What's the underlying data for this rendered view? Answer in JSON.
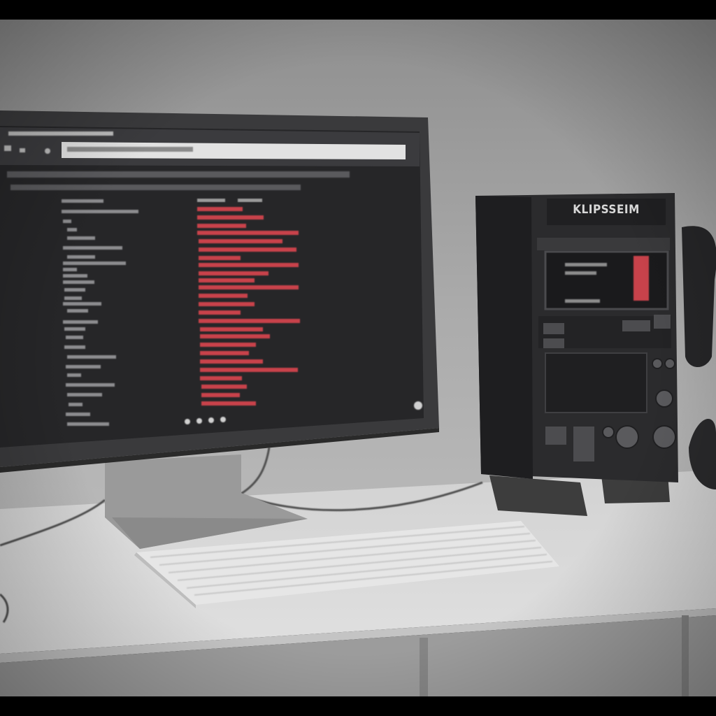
{
  "photo": {
    "device": {
      "brand_label": "KLIPSSEIM"
    },
    "palette": {
      "wall": "#a9a9a9",
      "desk": "#d9d9d9",
      "screen_bg": "#262628",
      "code_red": "#c8424c",
      "device_body": "#2b2b2d"
    }
  }
}
